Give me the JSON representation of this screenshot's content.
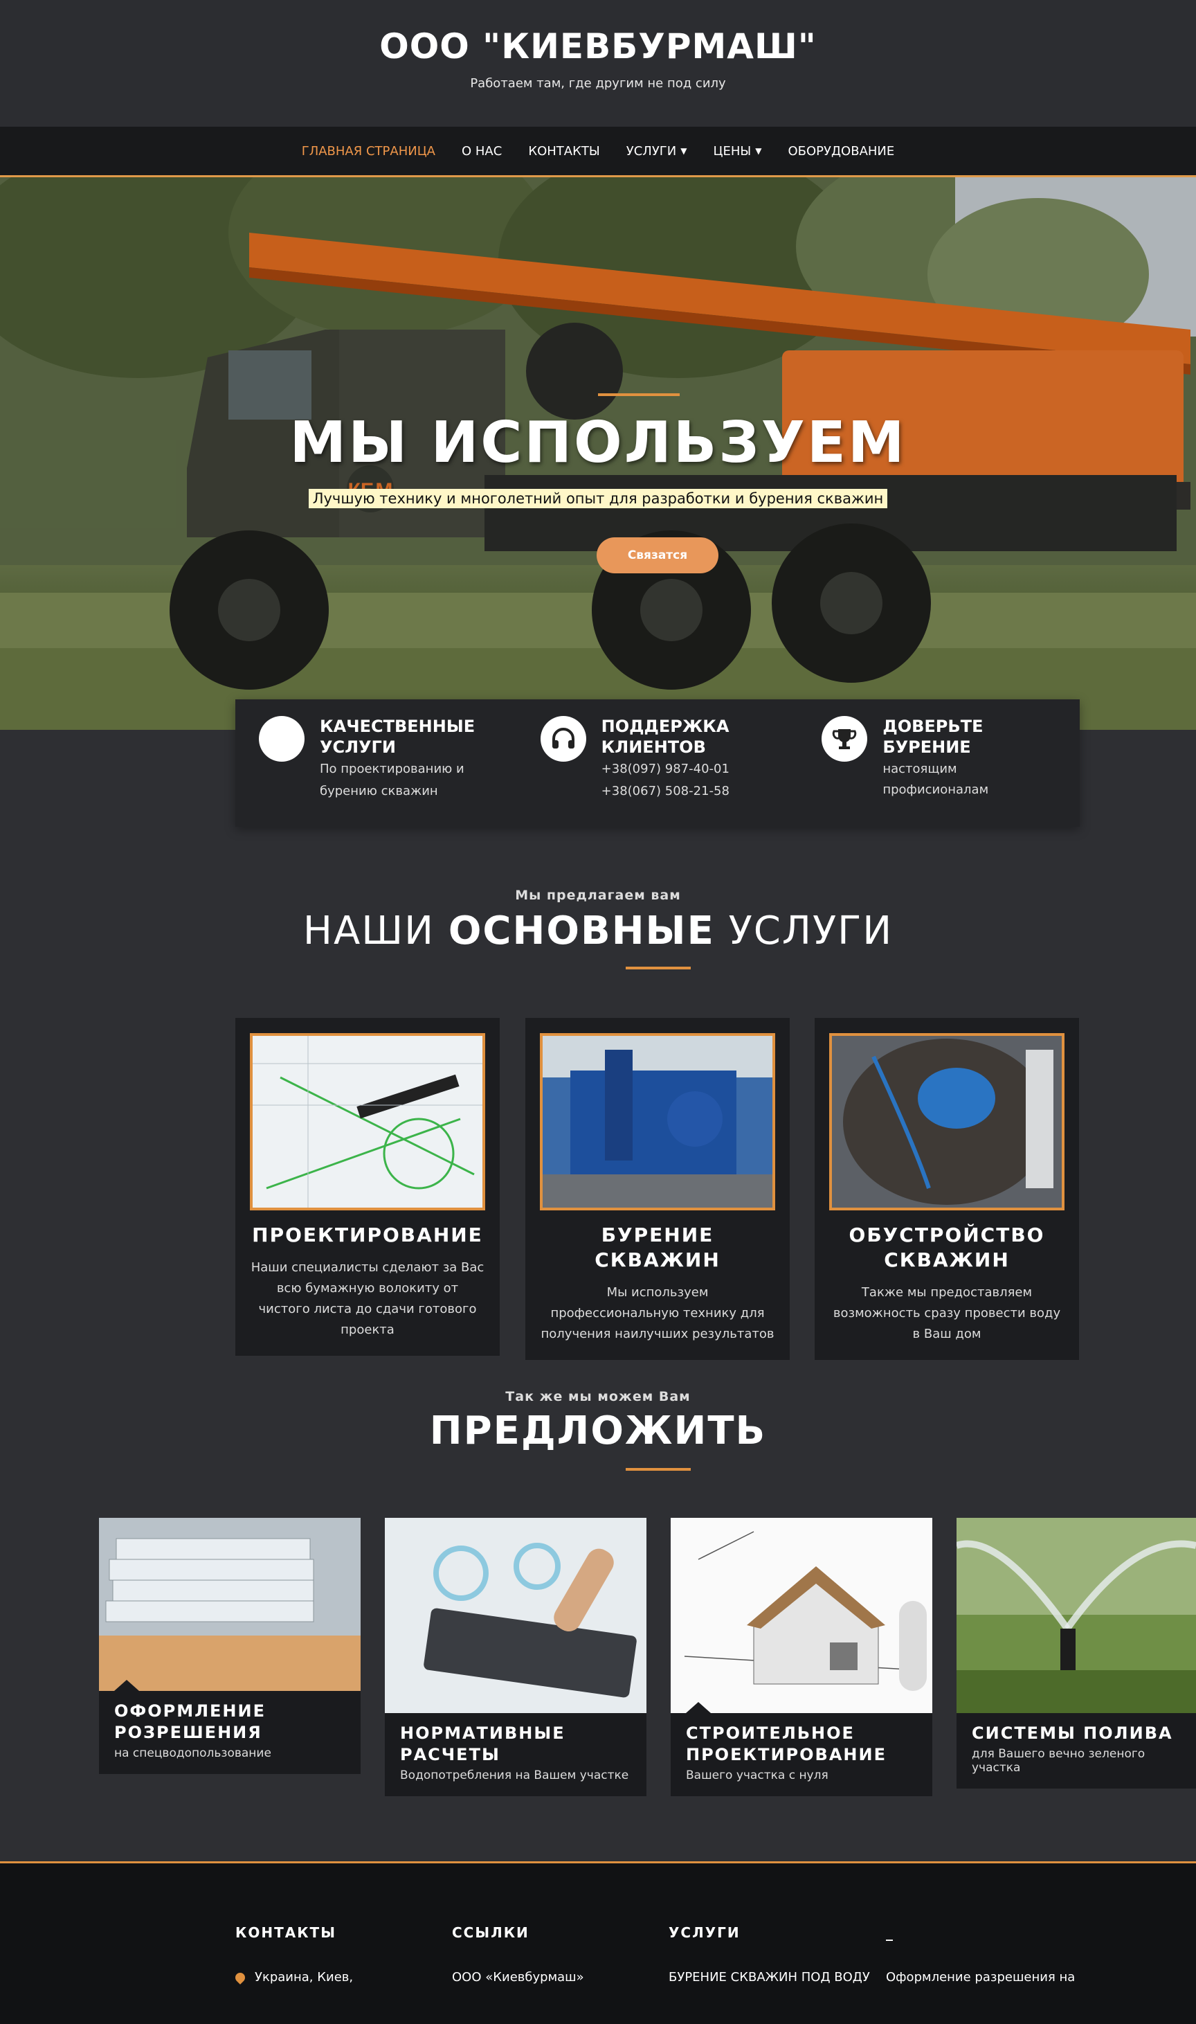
{
  "site": {
    "title": "ООО \"КИЕВБУРМАШ\"",
    "tagline": "Работаем там, где другим не под силу"
  },
  "nav": {
    "items": [
      {
        "label": "ГЛАВНАЯ СТРАНИЦА",
        "active": true,
        "has_dropdown": false
      },
      {
        "label": "О НАС",
        "active": false,
        "has_dropdown": false
      },
      {
        "label": "КОНТАКТЫ",
        "active": false,
        "has_dropdown": false
      },
      {
        "label": "УСЛУГИ",
        "active": false,
        "has_dropdown": true
      },
      {
        "label": "ЦЕНЫ",
        "active": false,
        "has_dropdown": true
      },
      {
        "label": "ОБОРУДОВАНИЕ",
        "active": false,
        "has_dropdown": false
      }
    ]
  },
  "hero": {
    "title": "МЫ ИСПОЛЬЗУЕМ",
    "subtitle": "Лучшую технику и многолетний опыт для разработки и бурения скважин",
    "button_label": "Связатся",
    "truck_logo": "КБМ"
  },
  "features": [
    {
      "icon": "circle-icon",
      "title": "КАЧЕСТВЕННЫЕ УСЛУГИ",
      "lines": [
        "По проектированию и",
        "бурению скважин"
      ]
    },
    {
      "icon": "headphones-icon",
      "title": "ПОДДЕРЖКА КЛИЕНТОВ",
      "lines": [
        "+38(097) 987-40-01",
        "+38(067) 508-21-58"
      ]
    },
    {
      "icon": "trophy-icon",
      "title": "ДОВЕРЬТЕ БУРЕНИЕ",
      "lines": [
        "настоящим профисионалам"
      ]
    }
  ],
  "services": {
    "kicker": "Мы предлагаем вам",
    "title_part1": "НАШИ ",
    "title_part2": "ОСНОВНЫЕ",
    "title_part3": " УСЛУГИ",
    "items": [
      {
        "title": "ПРОЕКТИРОВАНИЕ",
        "text": "Наши специалисты сделают за Вас всю бумажную волокиту от чистого листа до сдачи готового проекта"
      },
      {
        "title": "БУРЕНИЕ СКВАЖИН",
        "text": "Мы используем профессиональную технику для получения наилучших результатов"
      },
      {
        "title": "ОБУСТРОЙСТВО СКВАЖИН",
        "text": "Также мы предоставляем возможность сразу провести воду в Ваш дом"
      }
    ]
  },
  "offers": {
    "kicker": "Так же мы можем Вам",
    "title": "ПРЕДЛОЖИТЬ",
    "items": [
      {
        "title": "ОФОРМЛЕНИЕ РОЗРЕШЕНИЯ",
        "text": "на спецводопользование"
      },
      {
        "title": "НОРМАТИВНЫЕ РАСЧЕТЫ",
        "text": "Водопотребления на Вашем участке"
      },
      {
        "title": "СТРОИТЕЛЬНОЕ ПРОЕКТИРОВАНИЕ",
        "text": "Вашего участка с нуля"
      },
      {
        "title": "СИСТЕМЫ ПОЛИВА",
        "text": "для Вашего вечно зеленого участка"
      }
    ]
  },
  "footer": {
    "columns": [
      {
        "title": "КОНТАКТЫ",
        "link": "Украина, Киев,"
      },
      {
        "title": "ССЫЛКИ",
        "link": "ООО «Киевбурмаш»"
      },
      {
        "title": "УСЛУГИ",
        "link": "БУРЕНИЕ СКВАЖИН ПОД ВОДУ"
      },
      {
        "title": "_",
        "link": "Оформление разрешения на"
      }
    ]
  },
  "colors": {
    "accent": "#e0913f",
    "background": "#2e2f33",
    "nav_background": "#18191b",
    "card_background": "#1c1d20"
  }
}
